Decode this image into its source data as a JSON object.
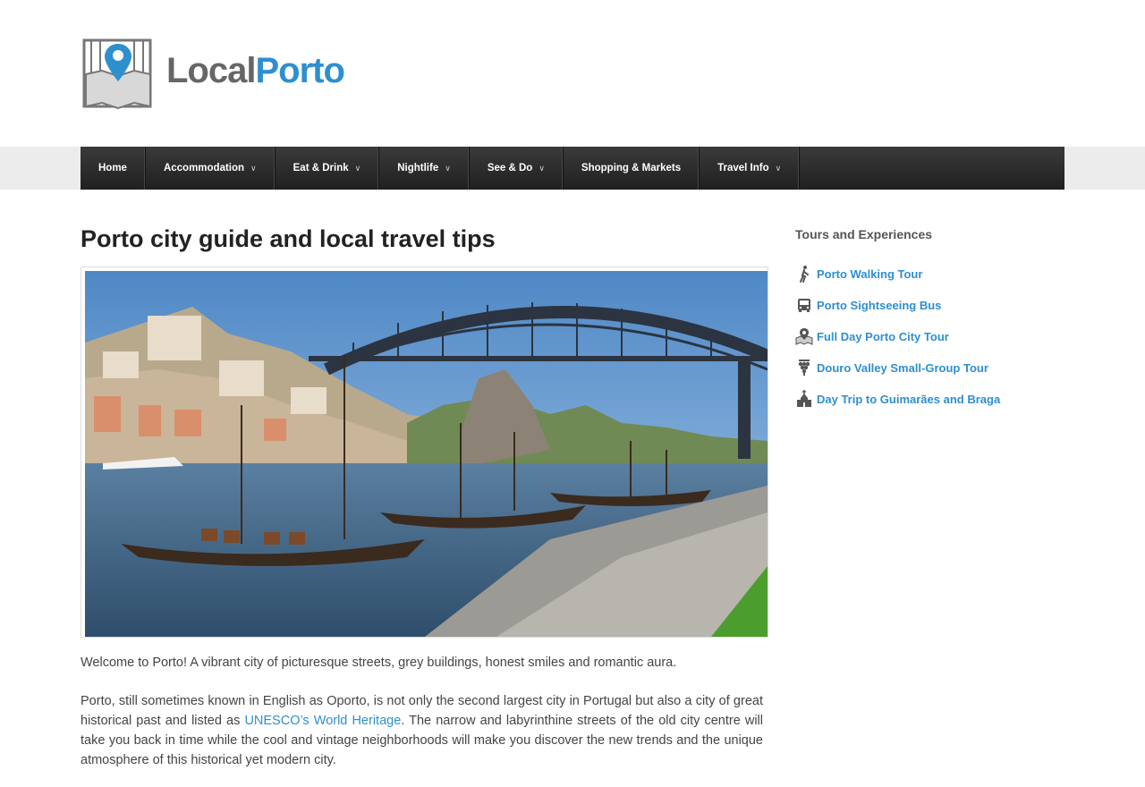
{
  "brand": {
    "name_part1": "Local",
    "name_part2": "Porto",
    "logo_color": "#2e8fcf"
  },
  "nav": {
    "items": [
      {
        "label": "Home",
        "dropdown": false
      },
      {
        "label": "Accommodation",
        "dropdown": true
      },
      {
        "label": "Eat & Drink",
        "dropdown": true
      },
      {
        "label": "Nightlife",
        "dropdown": true
      },
      {
        "label": "See & Do",
        "dropdown": true
      },
      {
        "label": "Shopping & Markets",
        "dropdown": false
      },
      {
        "label": "Travel Info",
        "dropdown": true
      }
    ]
  },
  "main": {
    "title": "Porto city guide and local travel tips",
    "intro": "Welcome to Porto! A vibrant city of picturesque streets, grey buildings, honest smiles and romantic aura.",
    "para2_before": "Porto, still sometimes known in English as Oporto, is not only the second largest city in Portugal but also a city of great historical past and listed as ",
    "para2_link": "UNESCO’s World Heritage",
    "para2_after": ". The narrow and labyrinthine streets of the old city centre will take you back in time while the cool and vintage neighborhoods will make you discover the new trends and the unique atmosphere of this historical yet modern city."
  },
  "sidebar": {
    "title": "Tours and Experiences",
    "tours": [
      {
        "label": "Porto Walking Tour",
        "icon": "walking-icon"
      },
      {
        "label": "Porto Sightseeing Bus",
        "icon": "bus-icon"
      },
      {
        "label": "Full Day Porto City Tour",
        "icon": "map-pin-icon"
      },
      {
        "label": "Douro Valley Small-Group Tour",
        "icon": "grapes-icon"
      },
      {
        "label": "Day Trip to Guimarães and Braga",
        "icon": "church-icon"
      }
    ]
  }
}
